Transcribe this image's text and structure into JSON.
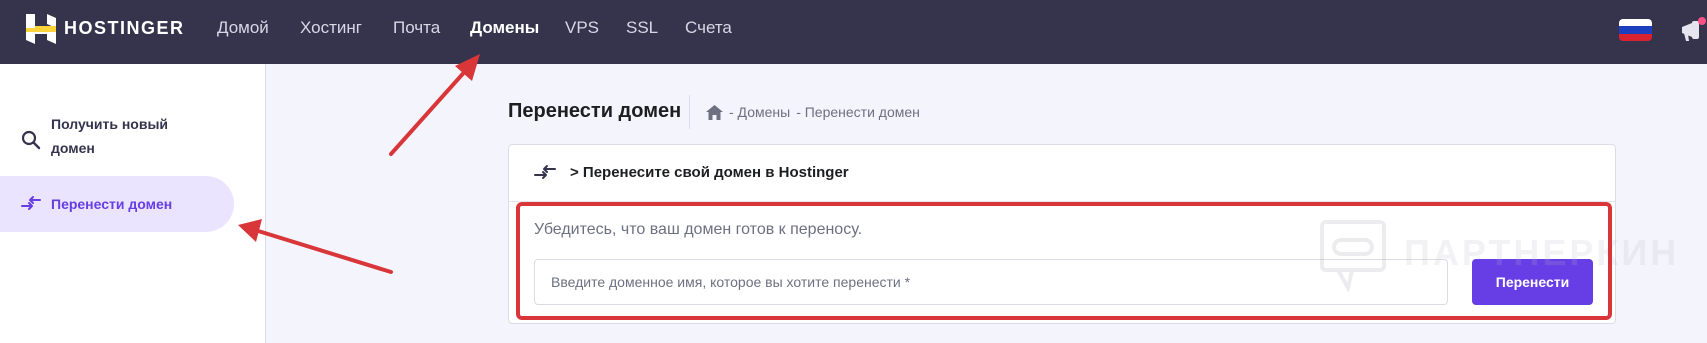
{
  "header": {
    "brand": "HOSTINGER",
    "nav": [
      {
        "label": "Домой",
        "active": false
      },
      {
        "label": "Хостинг",
        "active": false
      },
      {
        "label": "Почта",
        "active": false
      },
      {
        "label": "Домены",
        "active": true
      },
      {
        "label": "VPS",
        "active": false
      },
      {
        "label": "SSL",
        "active": false
      },
      {
        "label": "Счета",
        "active": false
      }
    ]
  },
  "sidebar": {
    "items": [
      {
        "label_line1": "Получить новый",
        "label_line2": "домен",
        "icon": "search-icon",
        "active": false
      },
      {
        "label": "Перенести домен",
        "icon": "transfer-icon",
        "active": true
      }
    ]
  },
  "main": {
    "title": "Перенести домен",
    "breadcrumb": {
      "home_icon": "home-icon",
      "items": [
        "- Домены",
        "- Перенести домен"
      ]
    },
    "card": {
      "header": "> Перенесите свой домен в Hostinger",
      "hint": "Убедитесь, что ваш домен готов к переносу.",
      "input_placeholder": "Введите доменное имя, которое вы хотите перенести *",
      "input_value": "",
      "button": "Перенести"
    }
  },
  "watermark": "ПАРТНЕРКИН",
  "colors": {
    "topbar": "#36344d",
    "accent": "#673de6",
    "highlight": "#d9363a",
    "active_bg": "#ebe4ff"
  }
}
